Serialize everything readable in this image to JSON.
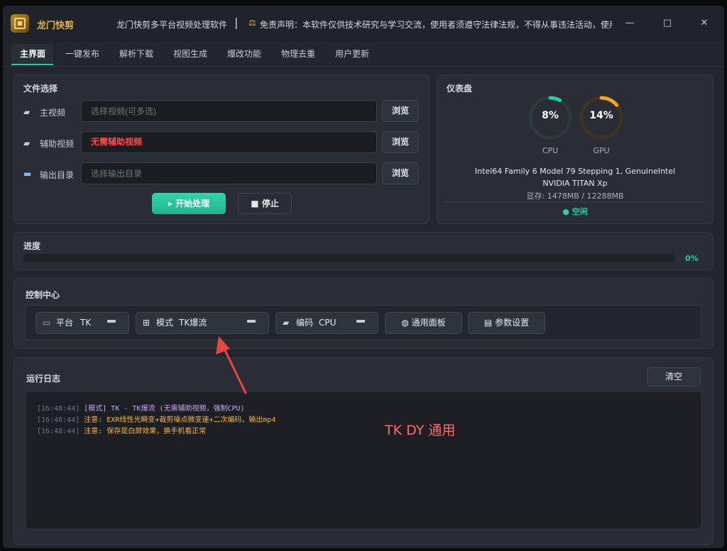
{
  "window": {
    "app_name": "龙门快剪",
    "subtitle": "龙门快剪多平台视频处理软件",
    "separator": "|",
    "disclaimer_icon": "scales-icon",
    "disclaimer": "免责声明：本软件仅供技术研究与学习交流，使用者须遵守法律法规，不得从事违法活动，使用即",
    "controls": {
      "minimize": "—",
      "maximize": "□",
      "close": "✕"
    }
  },
  "tabs": [
    "主界面",
    "一键发布",
    "解析下载",
    "视图生成",
    "爆改功能",
    "物理去重",
    "用户更新"
  ],
  "file_select": {
    "title": "文件选择",
    "rows": [
      {
        "icon": "video-icon",
        "label": "主视频",
        "value": "",
        "placeholder": "选择视频(可多选)",
        "button": "浏览"
      },
      {
        "icon": "video-icon",
        "label": "辅助视频",
        "value": "无需辅助视频",
        "placeholder": "",
        "button": "浏览"
      },
      {
        "icon": "folder-icon",
        "label": "输出目录",
        "value": "",
        "placeholder": "选择输出目录",
        "button": "浏览"
      }
    ],
    "start_button": "▸ 开始处理",
    "stop_button": "■ 停止"
  },
  "dashboard": {
    "title": "仪表盘",
    "cpu": {
      "value": "8%",
      "label": "CPU",
      "percent": 8,
      "color": "#2ec9a0"
    },
    "gpu": {
      "value": "14%",
      "label": "GPU",
      "percent": 14,
      "color": "#f5a623"
    },
    "cpu_info": "Intel64 Family 6 Model 79 Stepping 1, GenuineIntel",
    "gpu_info": "NVIDIA TITAN Xp",
    "memory": "显存: 1478MB / 12288MB",
    "status": "● 空闲"
  },
  "progress": {
    "title": "进度",
    "percent": 0,
    "label": "0%"
  },
  "control_center": {
    "title": "控制中心",
    "platform": {
      "label": "平台",
      "value": "TK"
    },
    "mode": {
      "label": "模式",
      "value": "TK爆流"
    },
    "encoding": {
      "label": "编码",
      "value": "CPU"
    },
    "general_panel_button": "通用面板",
    "settings_button": "参数设置"
  },
  "log": {
    "title": "运行日志",
    "clear_button": "清空",
    "lines": [
      {
        "time": "[16:48:44]",
        "text": "[模式] TK - TK爆流 (无需辅助视频，强制CPU)",
        "type": "mode"
      },
      {
        "time": "[16:48:44]",
        "text": "注意: EXR线性光瞬变+裁剪噪点微变速+二次编码，输出mp4",
        "type": "warn"
      },
      {
        "time": "[16:48:44]",
        "text": "注意: 保存是白屏效果，换手机看正常",
        "type": "warn"
      }
    ]
  },
  "annotation": {
    "text": "TK DY 通用",
    "color": "#ff6b6b"
  }
}
